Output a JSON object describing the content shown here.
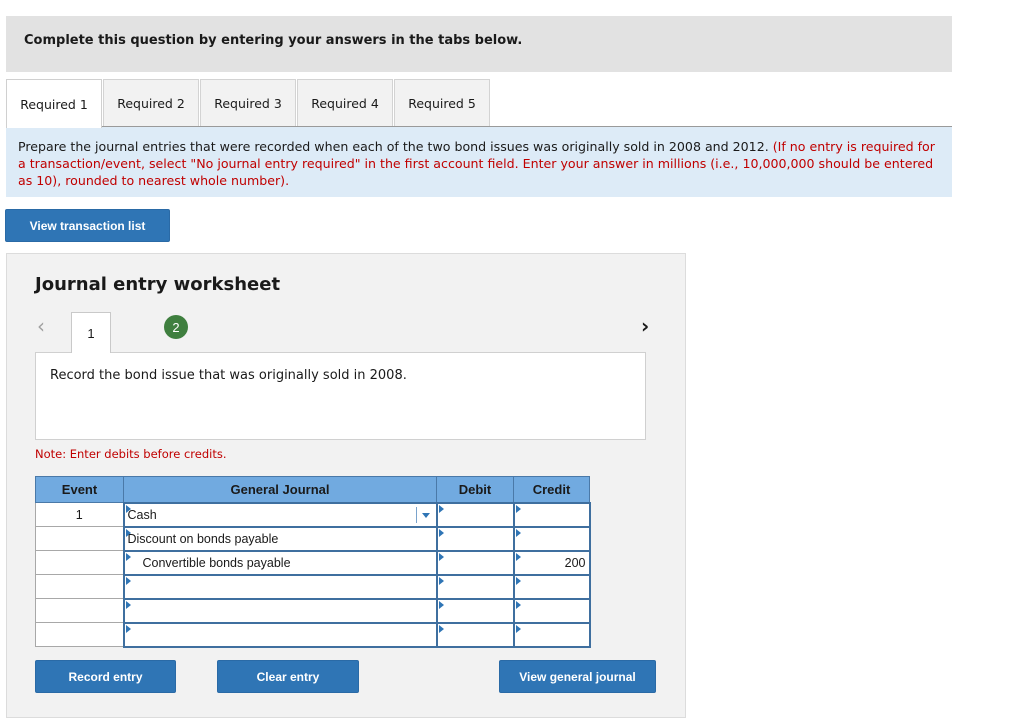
{
  "header": {
    "title": "Complete this question by entering your answers in the tabs below."
  },
  "tabs": [
    {
      "label": "Required 1",
      "active": true
    },
    {
      "label": "Required 2",
      "active": false
    },
    {
      "label": "Required 3",
      "active": false
    },
    {
      "label": "Required 4",
      "active": false
    },
    {
      "label": "Required 5",
      "active": false
    }
  ],
  "instructions": {
    "main": "Prepare the journal entries that were recorded when each of the two bond issues was originally sold in 2008 and 2012. ",
    "note": "(If no entry is required for a transaction/event, select \"No journal entry required\" in the first account field. Enter your answer in millions (i.e., 10,000,000 should be entered as 10), rounded to nearest whole number)."
  },
  "buttons": {
    "view_transaction_list": "View transaction list",
    "record_entry": "Record entry",
    "clear_entry": "Clear entry",
    "view_general_journal": "View general journal"
  },
  "worksheet": {
    "title": "Journal entry worksheet",
    "prev_icon": "‹",
    "next_icon": "›",
    "entry_tabs": [
      "1",
      "2"
    ],
    "active_entry": "1",
    "description": "Record the bond issue that was originally sold in 2008.",
    "note": "Note: Enter debits before credits.",
    "columns": [
      "Event",
      "General Journal",
      "Debit",
      "Credit"
    ],
    "rows": [
      {
        "event": "1",
        "account": "Cash",
        "debit": "",
        "credit": ""
      },
      {
        "event": "",
        "account": "Discount on bonds payable",
        "debit": "",
        "credit": ""
      },
      {
        "event": "",
        "account": "Convertible bonds payable",
        "debit": "",
        "credit": "200"
      },
      {
        "event": "",
        "account": "",
        "debit": "",
        "credit": ""
      },
      {
        "event": "",
        "account": "",
        "debit": "",
        "credit": ""
      },
      {
        "event": "",
        "account": "",
        "debit": "",
        "credit": ""
      }
    ]
  },
  "colors": {
    "button_blue": "#2f75b5",
    "table_header_blue": "#71aae0",
    "instruction_bg": "#ddebf7",
    "note_red": "#c00000",
    "badge_green": "#3f7f3f"
  }
}
